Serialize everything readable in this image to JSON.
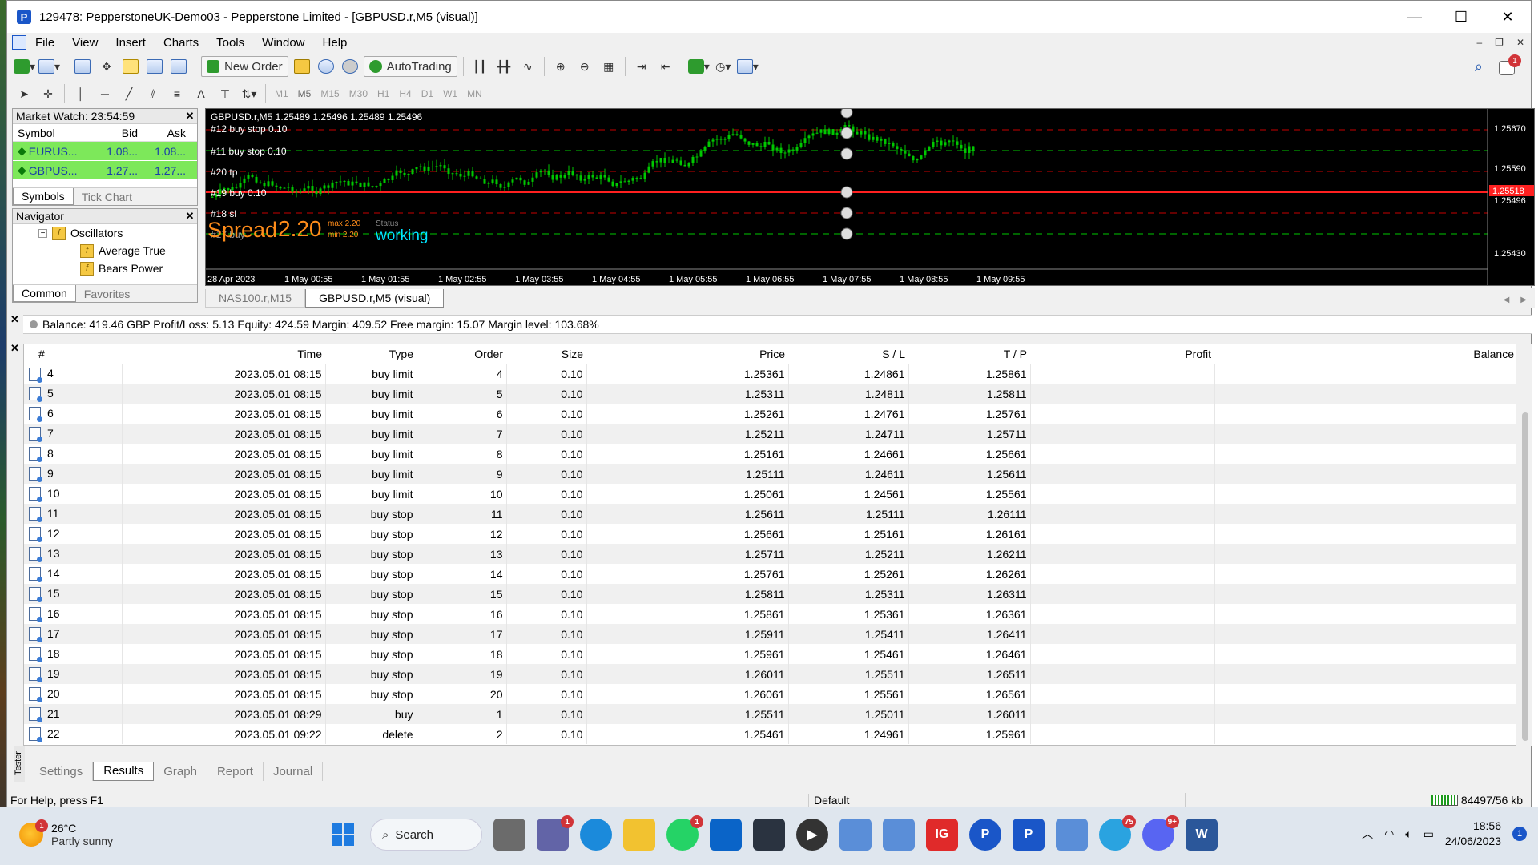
{
  "window": {
    "title": "129478: PepperstoneUK-Demo03 - Pepperstone Limited - [GBPUSD.r,M5 (visual)]",
    "controls": [
      "—",
      "☐",
      "✕"
    ]
  },
  "menu": [
    "File",
    "View",
    "Insert",
    "Charts",
    "Tools",
    "Window",
    "Help"
  ],
  "toolbar": {
    "new_order": "New Order",
    "autotrading": "AutoTrading",
    "timeframes": [
      "M1",
      "M5",
      "M15",
      "M30",
      "H1",
      "H4",
      "D1",
      "W1",
      "MN"
    ],
    "active_timeframe": "M5",
    "notification_count": "1",
    "text_tool": "A"
  },
  "market_watch": {
    "title": "Market Watch: 23:54:59",
    "columns": [
      "Symbol",
      "Bid",
      "Ask"
    ],
    "rows": [
      {
        "symbol": "EURUS...",
        "bid": "1.08...",
        "ask": "1.08..."
      },
      {
        "symbol": "GBPUS...",
        "bid": "1.27...",
        "ask": "1.27..."
      }
    ],
    "tabs": [
      "Symbols",
      "Tick Chart"
    ]
  },
  "navigator": {
    "title": "Navigator",
    "items": [
      "Oscillators",
      "Average True",
      "Bears Power"
    ],
    "tabs": [
      "Common",
      "Favorites"
    ]
  },
  "chart": {
    "header": "GBPUSD.r,M5  1.25489 1.25496 1.25489 1.25496",
    "labels": [
      "#12 buy stop 0.10",
      "#11 buy stop 0.10",
      "#20 tp",
      "#19 buy 0.10",
      "#18 sl",
      "#17 buy"
    ],
    "spread_label": "Spread",
    "spread_value": "2.20",
    "spread_max": "max 2.20",
    "spread_min": "min 2.20",
    "status_label": "Status",
    "status_value": "working",
    "price_ticks": [
      "1.25670",
      "1.25590",
      "1.25496",
      "1.25430"
    ],
    "current_price": "1.25518",
    "time_ticks": [
      "28 Apr 2023",
      "1 May 00:55",
      "1 May 01:55",
      "1 May 02:55",
      "1 May 03:55",
      "1 May 04:55",
      "1 May 05:55",
      "1 May 06:55",
      "1 May 07:55",
      "1 May 08:55",
      "1 May 09:55"
    ],
    "tabs": [
      "NAS100.r,M15",
      "GBPUSD.r,M5 (visual)"
    ],
    "colors": {
      "candles": "#00c800",
      "order_lines": "#c80000",
      "grid": "#00c800",
      "spread": "#ff8c1a",
      "status": "#00e5ff"
    }
  },
  "account": "Balance: 419.46 GBP  Profit/Loss: 5.13  Equity: 424.59  Margin: 409.52  Free margin: 15.07  Margin level: 103.68%",
  "results": {
    "columns": [
      "#",
      "Time",
      "Type",
      "Order",
      "Size",
      "Price",
      "S / L",
      "T / P",
      "Profit",
      "Balance"
    ],
    "rows": [
      [
        "4",
        "2023.05.01 08:15",
        "buy limit",
        "4",
        "0.10",
        "1.25361",
        "1.24861",
        "1.25861",
        "",
        ""
      ],
      [
        "5",
        "2023.05.01 08:15",
        "buy limit",
        "5",
        "0.10",
        "1.25311",
        "1.24811",
        "1.25811",
        "",
        ""
      ],
      [
        "6",
        "2023.05.01 08:15",
        "buy limit",
        "6",
        "0.10",
        "1.25261",
        "1.24761",
        "1.25761",
        "",
        ""
      ],
      [
        "7",
        "2023.05.01 08:15",
        "buy limit",
        "7",
        "0.10",
        "1.25211",
        "1.24711",
        "1.25711",
        "",
        ""
      ],
      [
        "8",
        "2023.05.01 08:15",
        "buy limit",
        "8",
        "0.10",
        "1.25161",
        "1.24661",
        "1.25661",
        "",
        ""
      ],
      [
        "9",
        "2023.05.01 08:15",
        "buy limit",
        "9",
        "0.10",
        "1.25111",
        "1.24611",
        "1.25611",
        "",
        ""
      ],
      [
        "10",
        "2023.05.01 08:15",
        "buy limit",
        "10",
        "0.10",
        "1.25061",
        "1.24561",
        "1.25561",
        "",
        ""
      ],
      [
        "11",
        "2023.05.01 08:15",
        "buy stop",
        "11",
        "0.10",
        "1.25611",
        "1.25111",
        "1.26111",
        "",
        ""
      ],
      [
        "12",
        "2023.05.01 08:15",
        "buy stop",
        "12",
        "0.10",
        "1.25661",
        "1.25161",
        "1.26161",
        "",
        ""
      ],
      [
        "13",
        "2023.05.01 08:15",
        "buy stop",
        "13",
        "0.10",
        "1.25711",
        "1.25211",
        "1.26211",
        "",
        ""
      ],
      [
        "14",
        "2023.05.01 08:15",
        "buy stop",
        "14",
        "0.10",
        "1.25761",
        "1.25261",
        "1.26261",
        "",
        ""
      ],
      [
        "15",
        "2023.05.01 08:15",
        "buy stop",
        "15",
        "0.10",
        "1.25811",
        "1.25311",
        "1.26311",
        "",
        ""
      ],
      [
        "16",
        "2023.05.01 08:15",
        "buy stop",
        "16",
        "0.10",
        "1.25861",
        "1.25361",
        "1.26361",
        "",
        ""
      ],
      [
        "17",
        "2023.05.01 08:15",
        "buy stop",
        "17",
        "0.10",
        "1.25911",
        "1.25411",
        "1.26411",
        "",
        ""
      ],
      [
        "18",
        "2023.05.01 08:15",
        "buy stop",
        "18",
        "0.10",
        "1.25961",
        "1.25461",
        "1.26461",
        "",
        ""
      ],
      [
        "19",
        "2023.05.01 08:15",
        "buy stop",
        "19",
        "0.10",
        "1.26011",
        "1.25511",
        "1.26511",
        "",
        ""
      ],
      [
        "20",
        "2023.05.01 08:15",
        "buy stop",
        "20",
        "0.10",
        "1.26061",
        "1.25561",
        "1.26561",
        "",
        ""
      ],
      [
        "21",
        "2023.05.01 08:29",
        "buy",
        "1",
        "0.10",
        "1.25511",
        "1.25011",
        "1.26011",
        "",
        ""
      ],
      [
        "22",
        "2023.05.01 09:22",
        "delete",
        "2",
        "0.10",
        "1.25461",
        "1.24961",
        "1.25961",
        "",
        ""
      ]
    ]
  },
  "tester": {
    "label": "Tester",
    "tabs": [
      "Settings",
      "Results",
      "Graph",
      "Report",
      "Journal"
    ],
    "active_tab": "Results"
  },
  "status_bar": {
    "help": "For Help, press F1",
    "profile": "Default",
    "traffic": "84497/56 kb"
  },
  "taskbar": {
    "weather_badge": "1",
    "temperature": "26°C",
    "condition": "Partly sunny",
    "search": "Search",
    "badges": {
      "teams": "1",
      "whatsapp": "1",
      "telegram": "75",
      "discord": "9+"
    },
    "ig_label": "IG",
    "p_label": "P",
    "word_label": "W",
    "time": "18:56",
    "date": "24/06/2023",
    "tray_badge": "1"
  }
}
